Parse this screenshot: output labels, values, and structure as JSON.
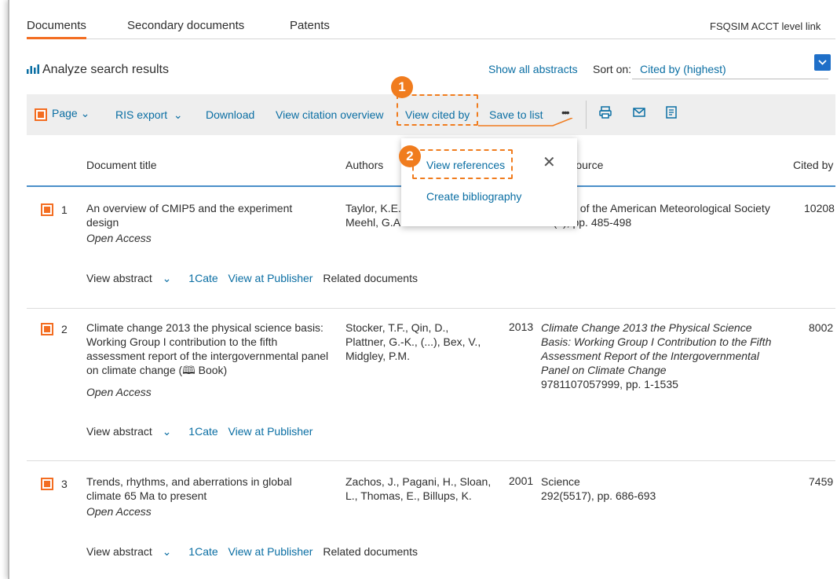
{
  "tabs": [
    "Documents",
    "Secondary documents",
    "Patents"
  ],
  "account_link": "FSQSIM ACCT level link",
  "analyze": {
    "label": "Analyze search results"
  },
  "show_abstracts": "Show all abstracts",
  "sort": {
    "label": "Sort on:",
    "value": "Cited by (highest)"
  },
  "toolbar": {
    "page_label": "Page",
    "ris_export": "RIS export",
    "download": "Download",
    "view_citation_overview": "View citation overview",
    "view_cited_by": "View cited by",
    "save_to_list": "Save to list",
    "more": "•••"
  },
  "badges": {
    "one": "1",
    "two": "2"
  },
  "dropdown": {
    "view_references": "View references",
    "create_bibliography": "Create bibliography",
    "close": "✕"
  },
  "table": {
    "headers": {
      "title": "Document title",
      "authors": "Authors",
      "source": "Source",
      "cited_by": "Cited by"
    },
    "rows": [
      {
        "num": "1",
        "title": "An overview of CMIP5 and the experiment design",
        "access": "Open Access",
        "authors": "Taylor, K.E., Stouffer, R.J., Meehl, G.A.",
        "year": "",
        "source": "Bulletin of the American Meteorological Society",
        "source_detail": "93(4), pp. 485-498",
        "cited_by": "10208",
        "actions": {
          "view_abstract": "View abstract",
          "cate": "1Cate",
          "publisher": "View at Publisher",
          "related": "Related documents"
        }
      },
      {
        "num": "2",
        "title": "Climate change 2013 the physical science basis: Working Group I contribution to the fifth assessment report of the intergovernmental panel on climate change",
        "book_tag": "Book",
        "access": "Open Access",
        "authors": "Stocker, T.F., Qin, D., Plattner, G.-K., (...), Bex, V., Midgley, P.M.",
        "year": "2013",
        "source": "Climate Change 2013 the Physical Science Basis: Working Group I Contribution to the Fifth Assessment Report of the Intergovernmental Panel on Climate Change",
        "source_detail": "9781107057999, pp. 1-1535",
        "cited_by": "8002",
        "actions": {
          "view_abstract": "View abstract",
          "cate": "1Cate",
          "publisher": "View at Publisher"
        }
      },
      {
        "num": "3",
        "title": "Trends, rhythms, and aberrations in global climate 65 Ma to present",
        "access": "Open Access",
        "authors": "Zachos, J., Pagani, H., Sloan, L., Thomas, E., Billups, K.",
        "year": "2001",
        "source": "Science",
        "source_detail": "292(5517), pp. 686-693",
        "cited_by": "7459",
        "actions": {
          "view_abstract": "View abstract",
          "cate": "1Cate",
          "publisher": "View at Publisher",
          "related": "Related documents"
        }
      }
    ]
  },
  "colors": {
    "accent": "#f36d21",
    "link": "#0a6ea3",
    "annotation": "#f07c1e",
    "header_rule": "#4a8fc9"
  }
}
